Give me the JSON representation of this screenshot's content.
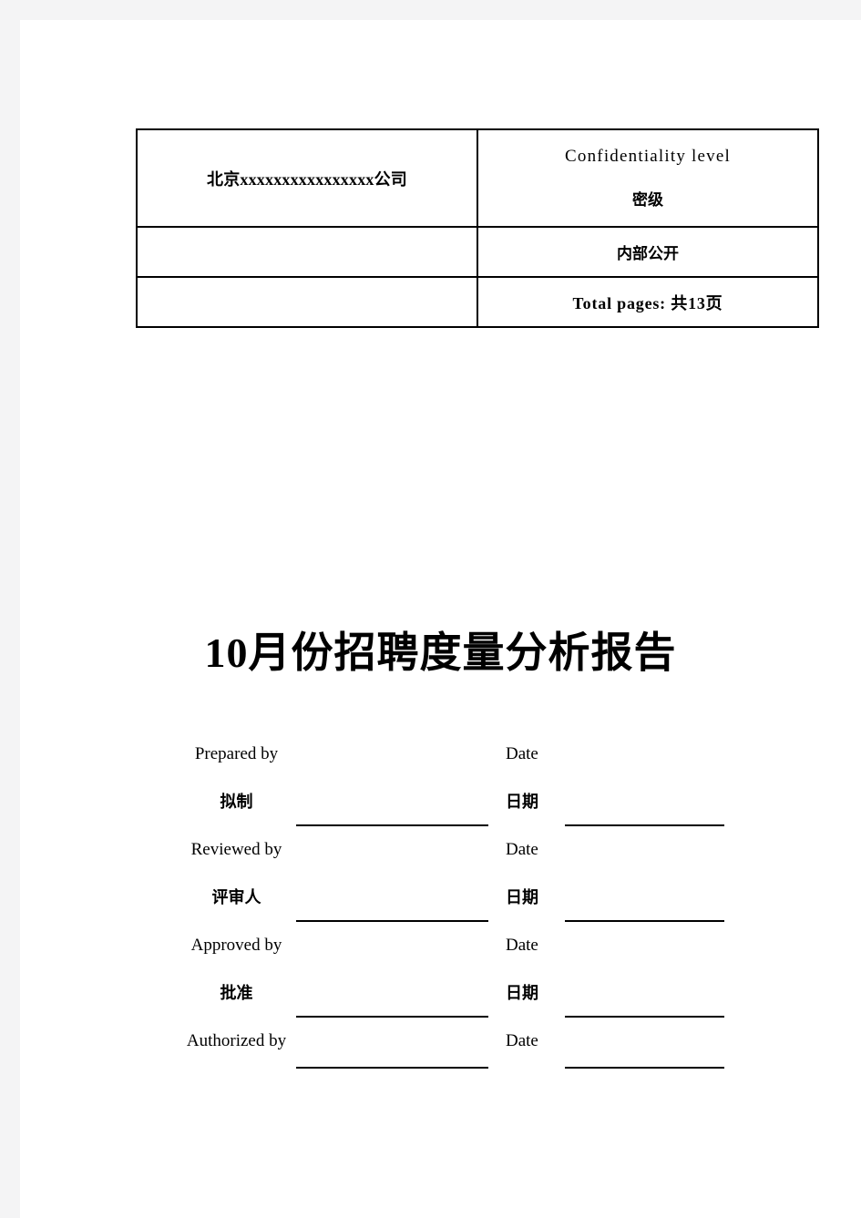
{
  "document": {
    "title": "10月份招聘度量分析报告"
  },
  "header_table": {
    "rows": [
      {
        "left": "北京xxxxxxxxxxxxxxxx公司",
        "right_line1": "Confidentiality level",
        "right_line2": "密级"
      },
      {
        "left": "",
        "right": "内部公开"
      },
      {
        "left": "",
        "right": "Total pages: 共13页"
      }
    ]
  },
  "signature_block": {
    "groups": [
      {
        "role_en": "Prepared by",
        "role_cn": "拟制",
        "date_en": "Date",
        "date_cn": "日期"
      },
      {
        "role_en": "Reviewed by",
        "role_cn": "评审人",
        "date_en": "Date",
        "date_cn": "日期"
      },
      {
        "role_en": "Approved by",
        "role_cn": "批准",
        "date_en": "Date",
        "date_cn": "日期"
      }
    ],
    "final_row": {
      "role_en": "Authorized by",
      "date_en": "Date"
    }
  },
  "colors": {
    "page_background": "#ffffff",
    "margin_background": "#f4f4f5",
    "text": "#000000",
    "border": "#000000"
  }
}
